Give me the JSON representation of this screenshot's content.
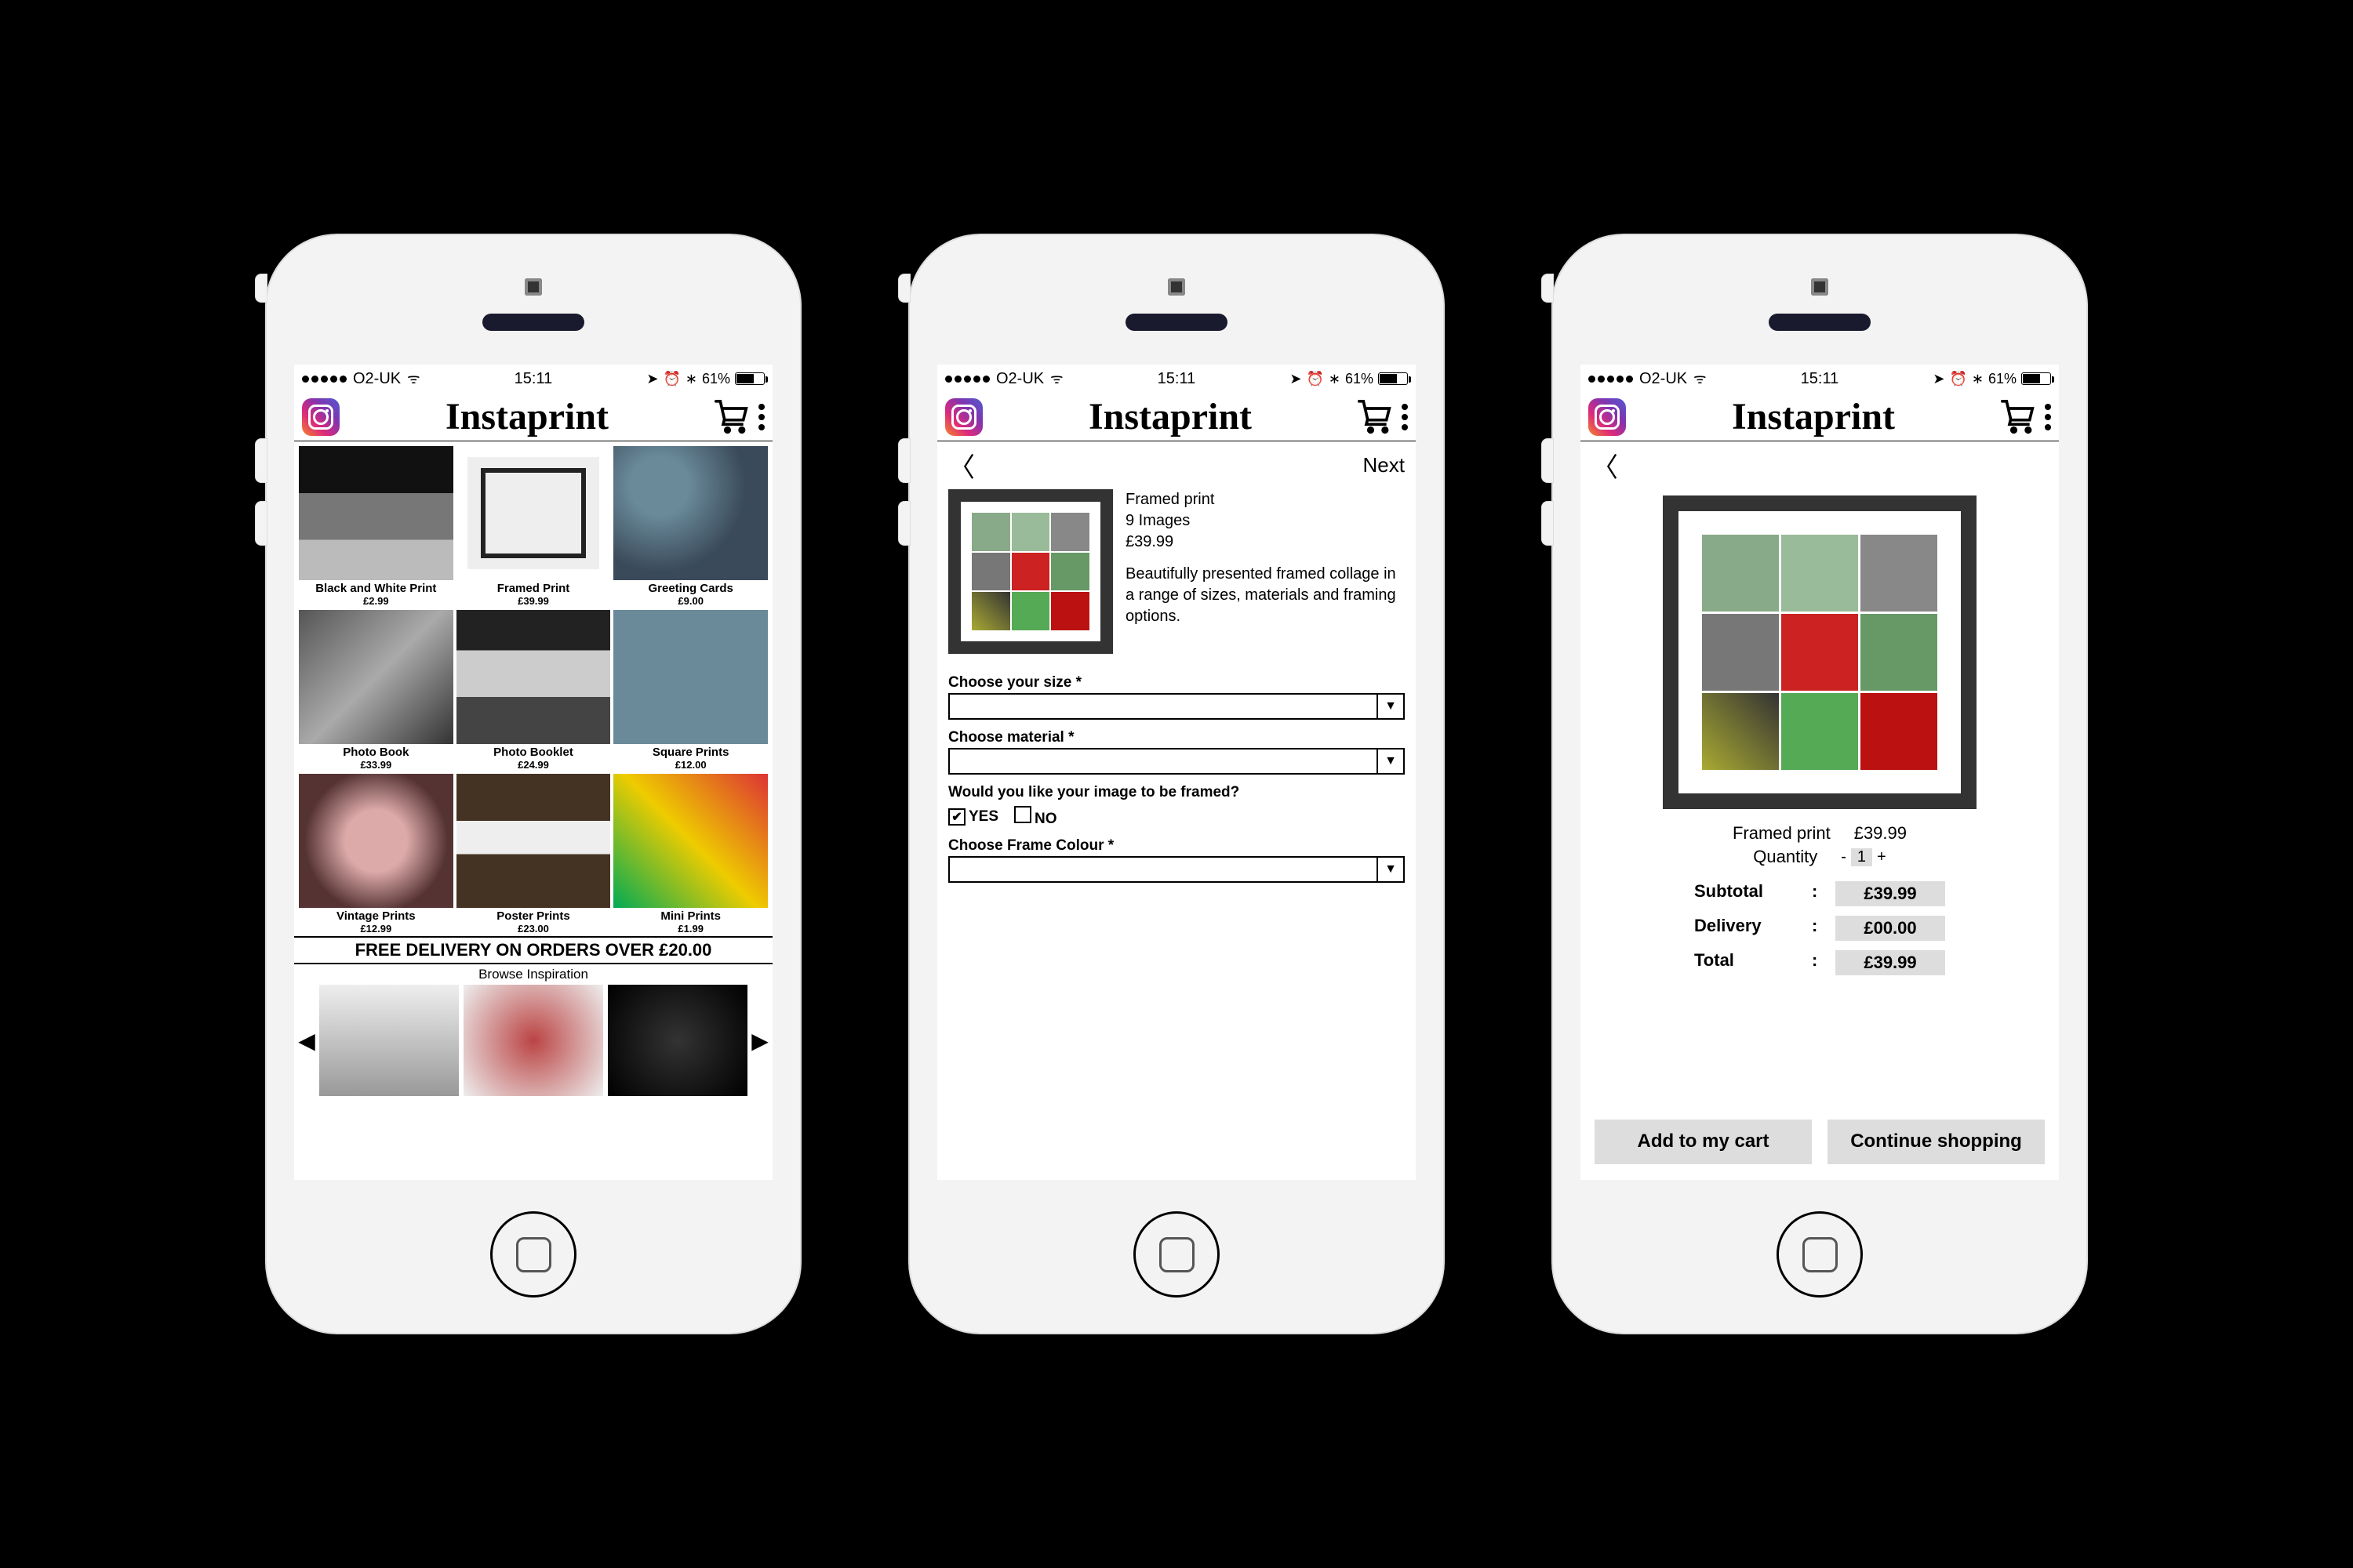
{
  "status": {
    "carrier": "O2-UK",
    "time": "15:11",
    "battery_pct": "61%"
  },
  "brand": "Instaprint",
  "screen1": {
    "products": [
      {
        "name": "Black and White Print",
        "price": "£2.99"
      },
      {
        "name": "Framed Print",
        "price": "£39.99"
      },
      {
        "name": "Greeting Cards",
        "price": "£9.00"
      },
      {
        "name": "Photo Book",
        "price": "£33.99"
      },
      {
        "name": "Photo Booklet",
        "price": "£24.99"
      },
      {
        "name": "Square Prints",
        "price": "£12.00"
      },
      {
        "name": "Vintage Prints",
        "price": "£12.99"
      },
      {
        "name": "Poster Prints",
        "price": "£23.00"
      },
      {
        "name": "Mini Prints",
        "price": "£1.99"
      }
    ],
    "banner": "FREE DELIVERY ON ORDERS OVER £20.00",
    "browse_label": "Browse Inspiration"
  },
  "screen2": {
    "next": "Next",
    "title": "Framed print",
    "images_line": "9 Images",
    "price": "£39.99",
    "desc": "Beautifully presented framed collage in a range of sizes, materials and framing options.",
    "label_size": "Choose your size *",
    "label_material": "Choose material *",
    "label_framed": "Would you like your image to be framed?",
    "yes": "YES",
    "no": "NO",
    "label_colour": "Choose Frame Colour *"
  },
  "screen3": {
    "title": "Framed print",
    "price": "£39.99",
    "quantity_label": "Quantity",
    "quantity": "1",
    "subtotal_label": "Subtotal",
    "subtotal": "£39.99",
    "delivery_label": "Delivery",
    "delivery": "£00.00",
    "total_label": "Total",
    "total": "£39.99",
    "btn_add": "Add to my cart",
    "btn_continue": "Continue shopping"
  }
}
